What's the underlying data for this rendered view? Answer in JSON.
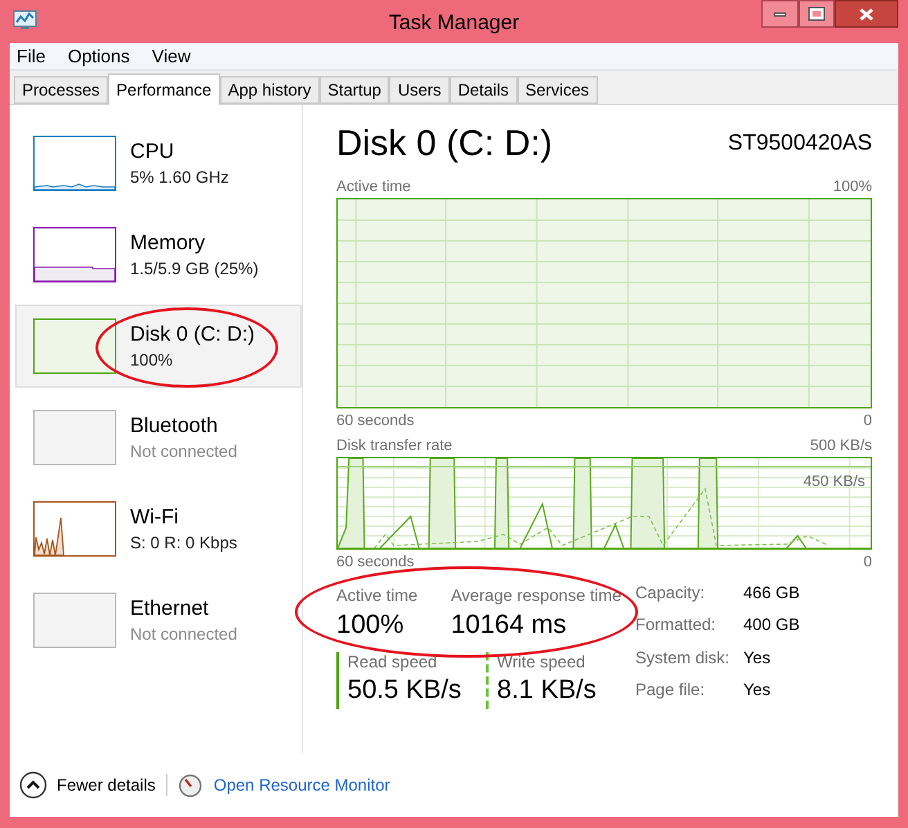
{
  "window": {
    "title": "Task Manager"
  },
  "menu": [
    "File",
    "Options",
    "View"
  ],
  "tabs": [
    {
      "label": "Processes",
      "selected": false
    },
    {
      "label": "Performance",
      "selected": true
    },
    {
      "label": "App history",
      "selected": false
    },
    {
      "label": "Startup",
      "selected": false
    },
    {
      "label": "Users",
      "selected": false
    },
    {
      "label": "Details",
      "selected": false
    },
    {
      "label": "Services",
      "selected": false
    }
  ],
  "sidebar": {
    "items": [
      {
        "name": "CPU",
        "detail": "5% 1.60 GHz",
        "kind": "line",
        "color": "#1b7fc4",
        "selected": false,
        "circled": false,
        "dim": false
      },
      {
        "name": "Memory",
        "detail": "1.5/5.9 GB (25%)",
        "kind": "fill",
        "color": "#8c1bb0",
        "selected": false,
        "circled": false,
        "dim": false
      },
      {
        "name": "Disk 0 (C: D:)",
        "detail": "100%",
        "kind": "full",
        "color": "#4ea50f",
        "selected": true,
        "circled": true,
        "dim": false
      },
      {
        "name": "Bluetooth",
        "detail": "Not connected",
        "kind": "empty",
        "color": "#b9b9b9",
        "selected": false,
        "circled": false,
        "dim": true
      },
      {
        "name": "Wi-Fi",
        "detail": "S: 0 R: 0 Kbps",
        "kind": "spikes",
        "color": "#a8561c",
        "selected": false,
        "circled": false,
        "dim": false
      },
      {
        "name": "Ethernet",
        "detail": "Not connected",
        "kind": "empty",
        "color": "#b9b9b9",
        "selected": false,
        "circled": false,
        "dim": true
      }
    ]
  },
  "detail": {
    "title": "Disk 0 (C: D:)",
    "model": "ST9500420AS",
    "active_chart": {
      "label": "Active time",
      "max": "100%",
      "span": "60 seconds",
      "min": "0",
      "level": 1
    },
    "transfer_chart": {
      "label": "Disk transfer rate",
      "max": "500 KB/s",
      "marker": "450 KB/s",
      "span": "60 seconds",
      "min": "0"
    },
    "stats_circled": true,
    "stats": [
      {
        "label": "Active time",
        "value": "100%"
      },
      {
        "label": "Average response time",
        "value": "10164 ms"
      }
    ],
    "speeds": [
      {
        "label": "Read speed",
        "value": "50.5 KB/s",
        "kind": "solid"
      },
      {
        "label": "Write speed",
        "value": "8.1 KB/s",
        "kind": "dashed"
      }
    ],
    "properties": [
      {
        "label": "Capacity:",
        "value": "466 GB"
      },
      {
        "label": "Formatted:",
        "value": "400 GB"
      },
      {
        "label": "System disk:",
        "value": "Yes"
      },
      {
        "label": "Page file:",
        "value": "Yes"
      }
    ]
  },
  "footer": {
    "toggle": "Fewer details",
    "link": "Open Resource Monitor"
  }
}
